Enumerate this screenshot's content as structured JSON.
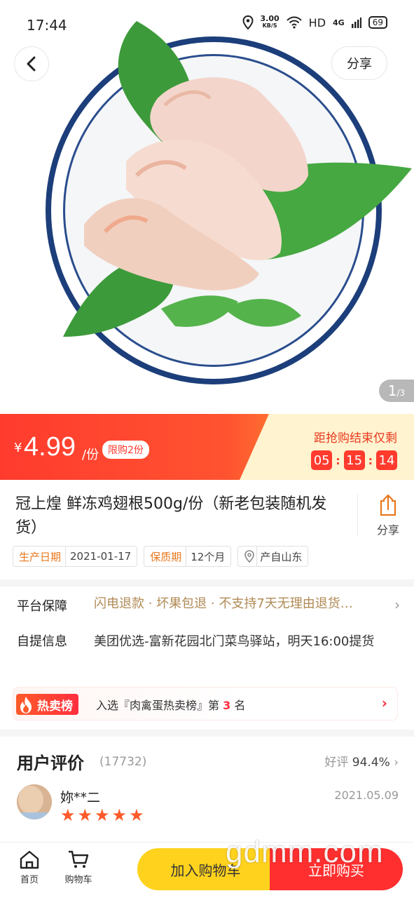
{
  "status_bar": {
    "time": "17:44",
    "speed_value": "3.00",
    "speed_unit": "KB/S",
    "hd": "HD",
    "network": "4G",
    "battery": "69"
  },
  "header": {
    "share_label": "分享",
    "page_current": "1",
    "page_total": "/3"
  },
  "price_bar": {
    "currency": "¥",
    "price": "4.99",
    "unit": "/份",
    "limit": "限购2份",
    "countdown_label": "距抢购结束仅剩",
    "countdown": [
      "05",
      "15",
      "14"
    ]
  },
  "product": {
    "title": "冠上煌 鲜冻鸡翅根500g/份（新老包装随机发货）",
    "share_label": "分享",
    "tags": [
      {
        "key": "生产日期",
        "value": "2021-01-17"
      },
      {
        "key": "保质期",
        "value": "12个月"
      }
    ],
    "origin": "产自山东"
  },
  "info": {
    "guarantee_label": "平台保障",
    "guarantee_value": "闪电退款 · 坏果包退 · 不支持7天无理由退货…",
    "pickup_label": "自提信息",
    "pickup_value": "美团优选-富新花园北门菜鸟驿站，明天16:00提货",
    "hot_badge": "热卖榜",
    "hot_prefix": "入选『肉禽蛋热卖榜』第",
    "hot_rank": "3",
    "hot_suffix": "名"
  },
  "reviews": {
    "title": "用户评价",
    "count": "(17732)",
    "rate_label": "好评",
    "rate_value": "94.4%",
    "user_name": "妳**二",
    "date": "2021.05.09",
    "stars": 5
  },
  "bottom_bar": {
    "home": "首页",
    "cart": "购物车",
    "add_to_cart": "加入购物车",
    "buy_now": "立即购买"
  },
  "watermark": "gdmm.com",
  "colors": {
    "accent_red": "#ff3b2e",
    "buy_yellow": "#ffd21e",
    "tag_orange": "#e8781e"
  }
}
